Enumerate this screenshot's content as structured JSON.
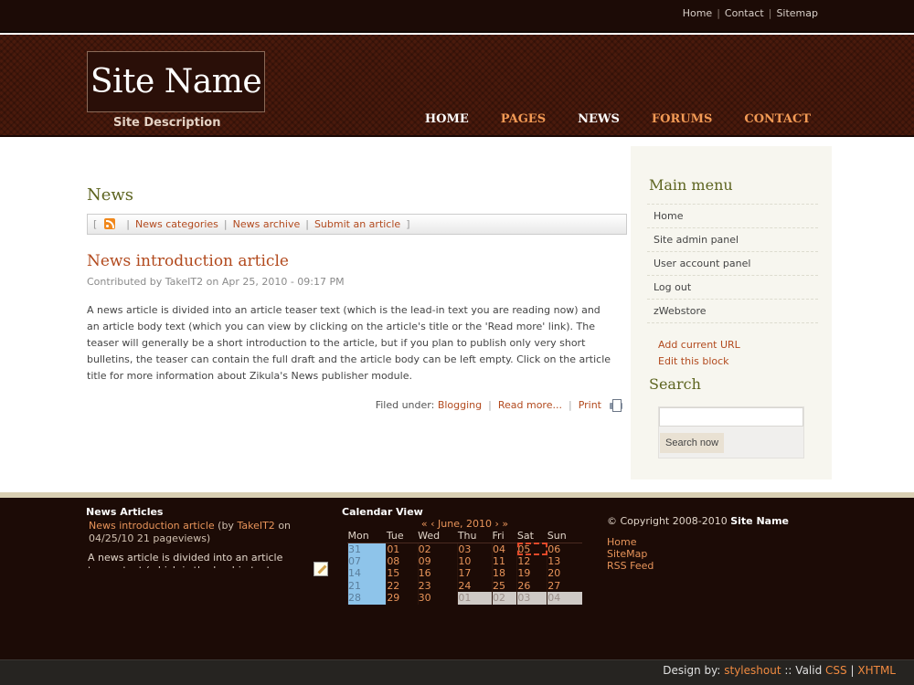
{
  "top_links": [
    "Home",
    "Contact",
    "Sitemap"
  ],
  "site": {
    "name": "Site Name",
    "description": "Site Description"
  },
  "nav": [
    {
      "label": "HOME"
    },
    {
      "label": "PAGES"
    },
    {
      "label": "NEWS"
    },
    {
      "label": "FORUMS"
    },
    {
      "label": "CONTACT"
    }
  ],
  "main": {
    "title": "News",
    "bar": {
      "open_bracket": "[",
      "close_bracket": "]",
      "links": [
        "News categories",
        "News archive",
        "Submit an article"
      ]
    },
    "article": {
      "title": "News introduction article",
      "meta": "Contributed by TakeIT2 on Apr 25, 2010 - 09:17 PM",
      "body": "A news article is divided into an article teaser text (which is the lead-in text you are reading now) and an article body text (which you can view by clicking on the article's title or the 'Read more' link). The teaser will generally be a short introduction to the article, but if you plan to publish only very short bulletins, the teaser can contain the full draft and the article body can be left empty. Click on the article title for more information about Zikula's News publisher module.",
      "filed_label": "Filed under:",
      "category": "Blogging",
      "read_more": "Read more...",
      "print": "Print"
    }
  },
  "sidebar": {
    "menu_title": "Main menu",
    "menu_items": [
      "Home",
      "Site admin panel",
      "User account panel",
      "Log out",
      "zWebstore"
    ],
    "block_links": [
      "Add current URL",
      "Edit this block"
    ],
    "search_title": "Search",
    "search_button": "Search now",
    "search_value": ""
  },
  "footer": {
    "articles_title": "News Articles",
    "article_link": "News introduction article",
    "article_by_pre": "(by",
    "article_author": "TakeIT2",
    "article_info": "on 04/25/10 21 pageviews)",
    "article_teaser": "A news article is divided into an article teaser text (which is the lead-in text you are reading now)",
    "calendar_title": "Calendar View",
    "calendar_nav": [
      "«",
      "‹",
      "June, 2010",
      "›",
      "»"
    ],
    "calendar_days": [
      "Mon",
      "Tue",
      "Wed",
      "Thu",
      "Fri",
      "Sat",
      "Sun"
    ],
    "calendar_weeks": [
      [
        "31",
        "01",
        "02",
        "03",
        "04",
        "05",
        "06"
      ],
      [
        "07",
        "08",
        "09",
        "10",
        "11",
        "12",
        "13"
      ],
      [
        "14",
        "15",
        "16",
        "17",
        "18",
        "19",
        "20"
      ],
      [
        "21",
        "22",
        "23",
        "24",
        "25",
        "26",
        "27"
      ],
      [
        "28",
        "29",
        "30",
        "01",
        "02",
        "03",
        "04"
      ]
    ],
    "calendar_today": "05",
    "copyright_pre": "© Copyright 2008-2010",
    "copyright_name": "Site Name",
    "links": [
      "Home",
      "SiteMap",
      "RSS Feed"
    ]
  },
  "credits": {
    "design_by": "Design by:",
    "designer": "styleshout",
    "sep": "::",
    "valid": "Valid",
    "css": "CSS",
    "pipe": "|",
    "xhtml": "XHTML"
  },
  "colors": {
    "accent": "#b24a1e",
    "header_bg": "#4a1a0c",
    "footer_bg": "#1c0b06",
    "heading_green": "#5d6420"
  }
}
